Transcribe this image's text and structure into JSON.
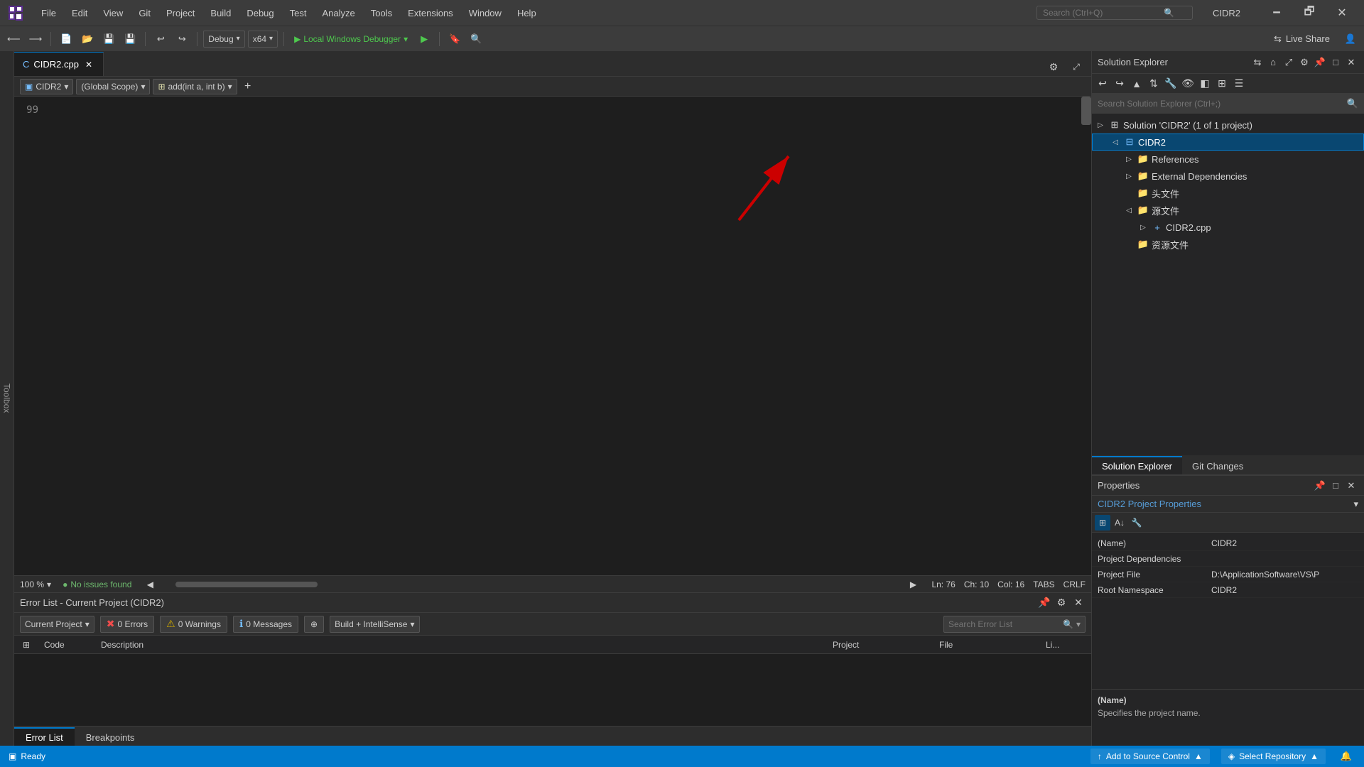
{
  "app": {
    "title": "CIDR2",
    "logo": "VS"
  },
  "titlebar": {
    "menus": [
      "File",
      "Edit",
      "View",
      "Git",
      "Project",
      "Build",
      "Debug",
      "Test",
      "Analyze",
      "Tools",
      "Extensions",
      "Window",
      "Help"
    ],
    "search_placeholder": "Search (Ctrl+Q)",
    "title": "CIDR2",
    "minimize": "🗕",
    "maximize": "🗗",
    "close": "✕"
  },
  "toolbar": {
    "debug_config": "Debug",
    "platform": "x64",
    "local_debugger": "Local Windows Debugger",
    "live_share": "Live Share"
  },
  "editor": {
    "tab_name": "CIDR2.cpp",
    "scope": "(Global Scope)",
    "function": "add(int a, int b)",
    "line_number": "99",
    "zoom": "100 %",
    "no_issues": "No issues found",
    "cursor": {
      "ln": "Ln: 76",
      "ch": "Ch: 10",
      "col": "Col: 16",
      "tabs": "TABS",
      "crlf": "CRLF"
    }
  },
  "bottom_panel": {
    "title": "Error List - Current Project (CIDR2)",
    "filter": "Current Project",
    "errors": "0 Errors",
    "warnings": "0 Warnings",
    "messages": "0 Messages",
    "build_filter": "Build + IntelliSense",
    "search_placeholder": "Search Error List",
    "columns": [
      "Code",
      "Description",
      "Project",
      "File",
      "Li..."
    ],
    "tabs": [
      "Error List",
      "Breakpoints"
    ]
  },
  "solution_explorer": {
    "title": "Solution Explorer",
    "search_placeholder": "Search Solution Explorer (Ctrl+;)",
    "tree": [
      {
        "id": "solution",
        "label": "Solution 'CIDR2' (1 of 1 project)",
        "icon": "solution",
        "indent": 0,
        "arrow": "▷",
        "expanded": true
      },
      {
        "id": "project",
        "label": "CIDR2",
        "icon": "project",
        "indent": 1,
        "arrow": "◁",
        "expanded": true,
        "selected": true
      },
      {
        "id": "references",
        "label": "References",
        "icon": "folder",
        "indent": 2,
        "arrow": "▷",
        "expanded": false
      },
      {
        "id": "external",
        "label": "External Dependencies",
        "icon": "folder",
        "indent": 2,
        "arrow": "▷",
        "expanded": false
      },
      {
        "id": "headers",
        "label": "头文件",
        "icon": "folder",
        "indent": 2,
        "arrow": "",
        "expanded": false
      },
      {
        "id": "source",
        "label": "源文件",
        "icon": "folder",
        "indent": 2,
        "arrow": "◁",
        "expanded": true
      },
      {
        "id": "cidr2cpp",
        "label": "CIDR2.cpp",
        "icon": "file",
        "indent": 3,
        "arrow": "▷",
        "expanded": false
      },
      {
        "id": "resources",
        "label": "资源文件",
        "icon": "folder",
        "indent": 2,
        "arrow": "",
        "expanded": false
      }
    ],
    "tabs": [
      "Solution Explorer",
      "Git Changes"
    ]
  },
  "properties": {
    "title": "Properties",
    "subtitle": "CIDR2 Project Properties",
    "rows": [
      {
        "key": "(Name)",
        "val": "CIDR2"
      },
      {
        "key": "Project Dependencies",
        "val": ""
      },
      {
        "key": "Project File",
        "val": "D:\\ApplicationSoftware\\VS\\P"
      },
      {
        "key": "Root Namespace",
        "val": "CIDR2"
      }
    ],
    "desc_key": "(Name)",
    "desc_val": "Specifies the project name."
  },
  "status_bar": {
    "ready": "Ready",
    "add_to_source_control": "Add to Source Control",
    "select_repository": "Select Repository"
  },
  "toolbox": {
    "label": "Toolbox"
  }
}
